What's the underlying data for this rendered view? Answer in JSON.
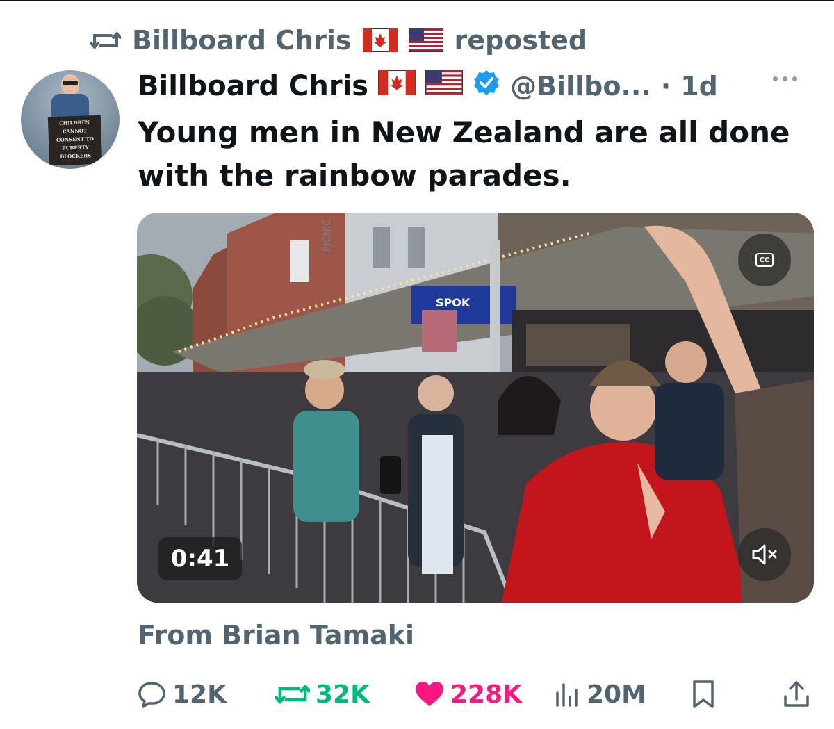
{
  "repost": {
    "icon": "repost-icon",
    "user": "Billboard Chris",
    "flags": [
      "canada-flag-icon",
      "us-flag-icon"
    ],
    "suffix": "reposted"
  },
  "tweet": {
    "author_name": "Billboard Chris",
    "verified": true,
    "handle": "@Billbo...",
    "separator": "·",
    "time": "1d",
    "text": "Young men in New Zealand are all done with the rainbow parades.",
    "avatar_sign": [
      "CHILDREN",
      "CANNOT",
      "CONSENT TO",
      "PUBERTY",
      "BLOCKERS"
    ],
    "video": {
      "duration": "0:41",
      "storefront_signs": [
        "PICNIC",
        "SPOK"
      ],
      "cc_icon": "closed-captions-icon",
      "mute_icon": "speaker-muted-icon"
    },
    "source": "From Brian Tamaki"
  },
  "actions": {
    "replies": "12K",
    "reposts": "32K",
    "likes": "228K",
    "views": "20M"
  },
  "colors": {
    "text_primary": "#0f1419",
    "text_secondary": "#536471",
    "repost_green": "#00ba7c",
    "like_pink": "#f91880",
    "verified_blue": "#1d9bf0"
  }
}
